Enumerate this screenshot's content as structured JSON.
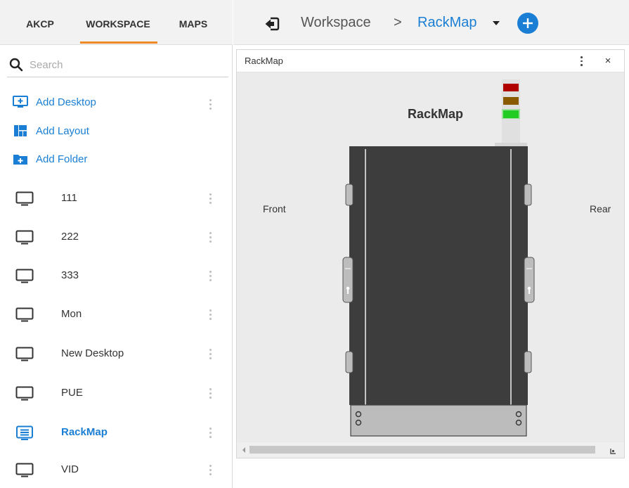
{
  "sidebar": {
    "tabs": [
      {
        "label": "AKCP"
      },
      {
        "label": "WORKSPACE"
      },
      {
        "label": "MAPS"
      }
    ],
    "active_tab": "WORKSPACE",
    "accent_color": "#f08a24",
    "search": {
      "placeholder": "Search",
      "value": ""
    },
    "actions": [
      {
        "label": "Add Desktop",
        "icon": "add-desktop-icon"
      },
      {
        "label": "Add Layout",
        "icon": "layout-icon"
      },
      {
        "label": "Add Folder",
        "icon": "add-folder-icon"
      }
    ],
    "desktops": [
      {
        "name": "111",
        "icon": "monitor-icon"
      },
      {
        "name": "222",
        "icon": "monitor-icon"
      },
      {
        "name": "333",
        "icon": "monitor-icon"
      },
      {
        "name": "Mon",
        "icon": "monitor-icon"
      },
      {
        "name": "New Desktop",
        "icon": "monitor-icon"
      },
      {
        "name": "PUE",
        "icon": "monitor-icon"
      },
      {
        "name": "RackMap",
        "icon": "map-list-icon",
        "active": true
      },
      {
        "name": "VID",
        "icon": "monitor-icon"
      }
    ]
  },
  "breadcrumb": {
    "root": "Workspace",
    "separator": ">",
    "current": "RackMap"
  },
  "widget": {
    "title": "RackMap",
    "close_label": "×",
    "rack_title": "RackMap",
    "front_label": "Front",
    "rear_label": "Rear",
    "status_lights": [
      "#b00000",
      "#8a5a00",
      "#22cc22"
    ]
  },
  "colors": {
    "link": "#1a7fd4",
    "rack_body": "#3d3d3d",
    "panel_bg": "#ebebeb"
  }
}
